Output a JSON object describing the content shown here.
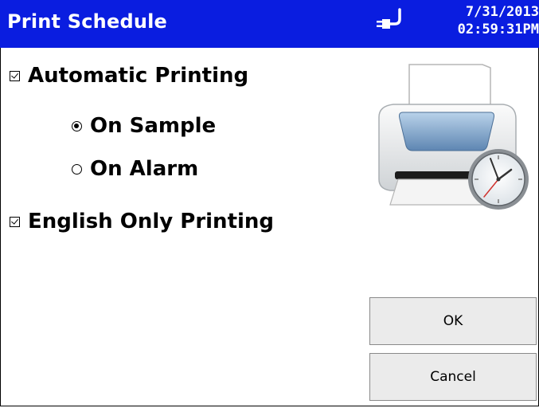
{
  "header": {
    "title": "Print Schedule",
    "date": "7/31/2013",
    "time": "02:59:31PM",
    "background": "#0a1de0"
  },
  "options": {
    "automatic_printing": {
      "label": "Automatic Printing",
      "checked": true
    },
    "on_sample": {
      "label": "On Sample",
      "selected": true
    },
    "on_alarm": {
      "label": "On Alarm",
      "selected": false
    },
    "english_only": {
      "label": "English Only Printing",
      "checked": true
    }
  },
  "buttons": {
    "ok": "OK",
    "cancel": "Cancel"
  },
  "icons": {
    "connection": "plug-icon",
    "printer": "printer-clock-icon"
  }
}
